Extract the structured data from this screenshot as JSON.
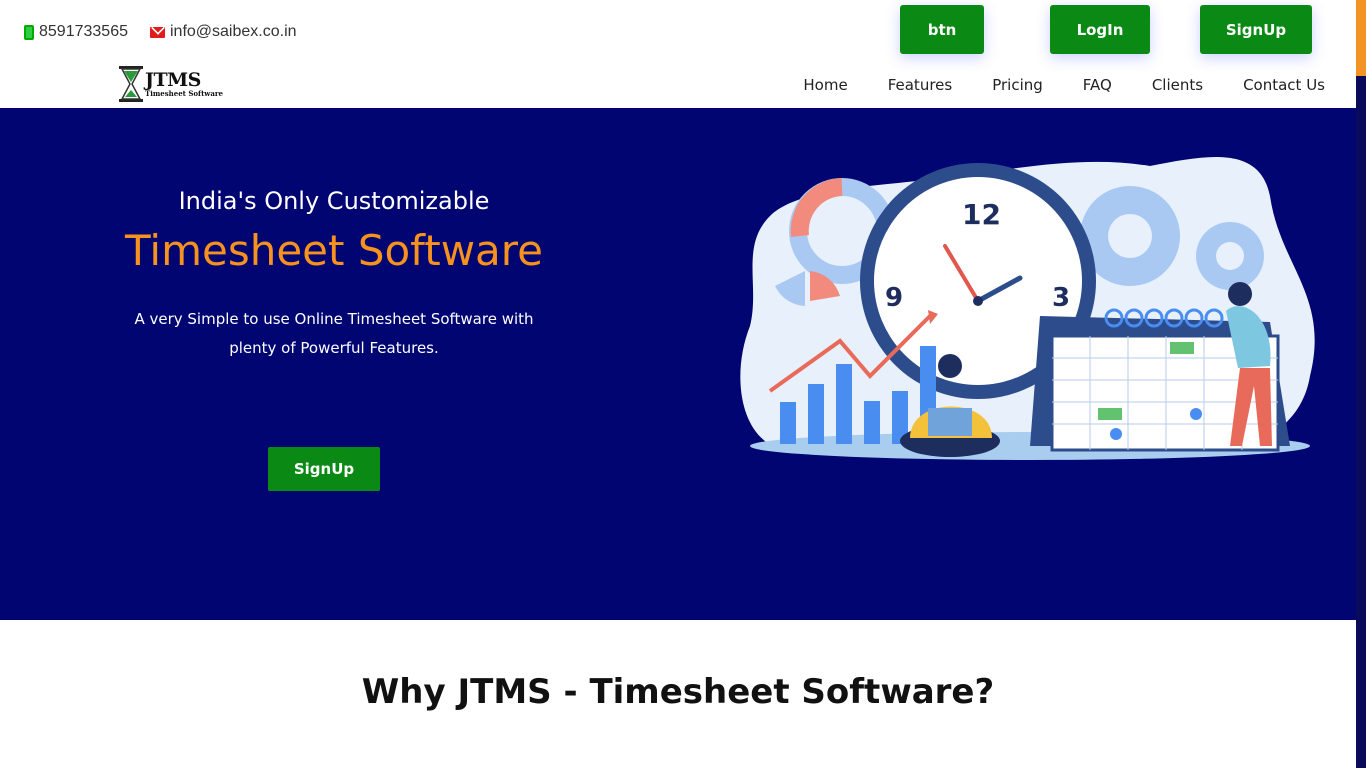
{
  "header": {
    "phone": "8591733565",
    "email": "info@saibex.co.in",
    "buttons": {
      "btn": "btn",
      "login": "LogIn",
      "signup": "SignUp"
    },
    "logo": {
      "title": "JTMS",
      "subtitle": "Timesheet Software"
    },
    "nav": [
      "Home",
      "Features",
      "Pricing",
      "FAQ",
      "Clients",
      "Contact Us"
    ]
  },
  "hero": {
    "subtitle": "India's Only Customizable",
    "title": "Timesheet Software",
    "description": "A very Simple to use Online Timesheet Software with plenty of Powerful Features.",
    "cta": "SignUp"
  },
  "section": {
    "title": "Why JTMS - Timesheet Software?"
  },
  "colors": {
    "brand_green": "#0a8a14",
    "hero_bg": "#000571",
    "accent_orange": "#f7921e"
  },
  "icons": [
    "phone-icon",
    "mail-icon",
    "hourglass-logo-icon"
  ]
}
